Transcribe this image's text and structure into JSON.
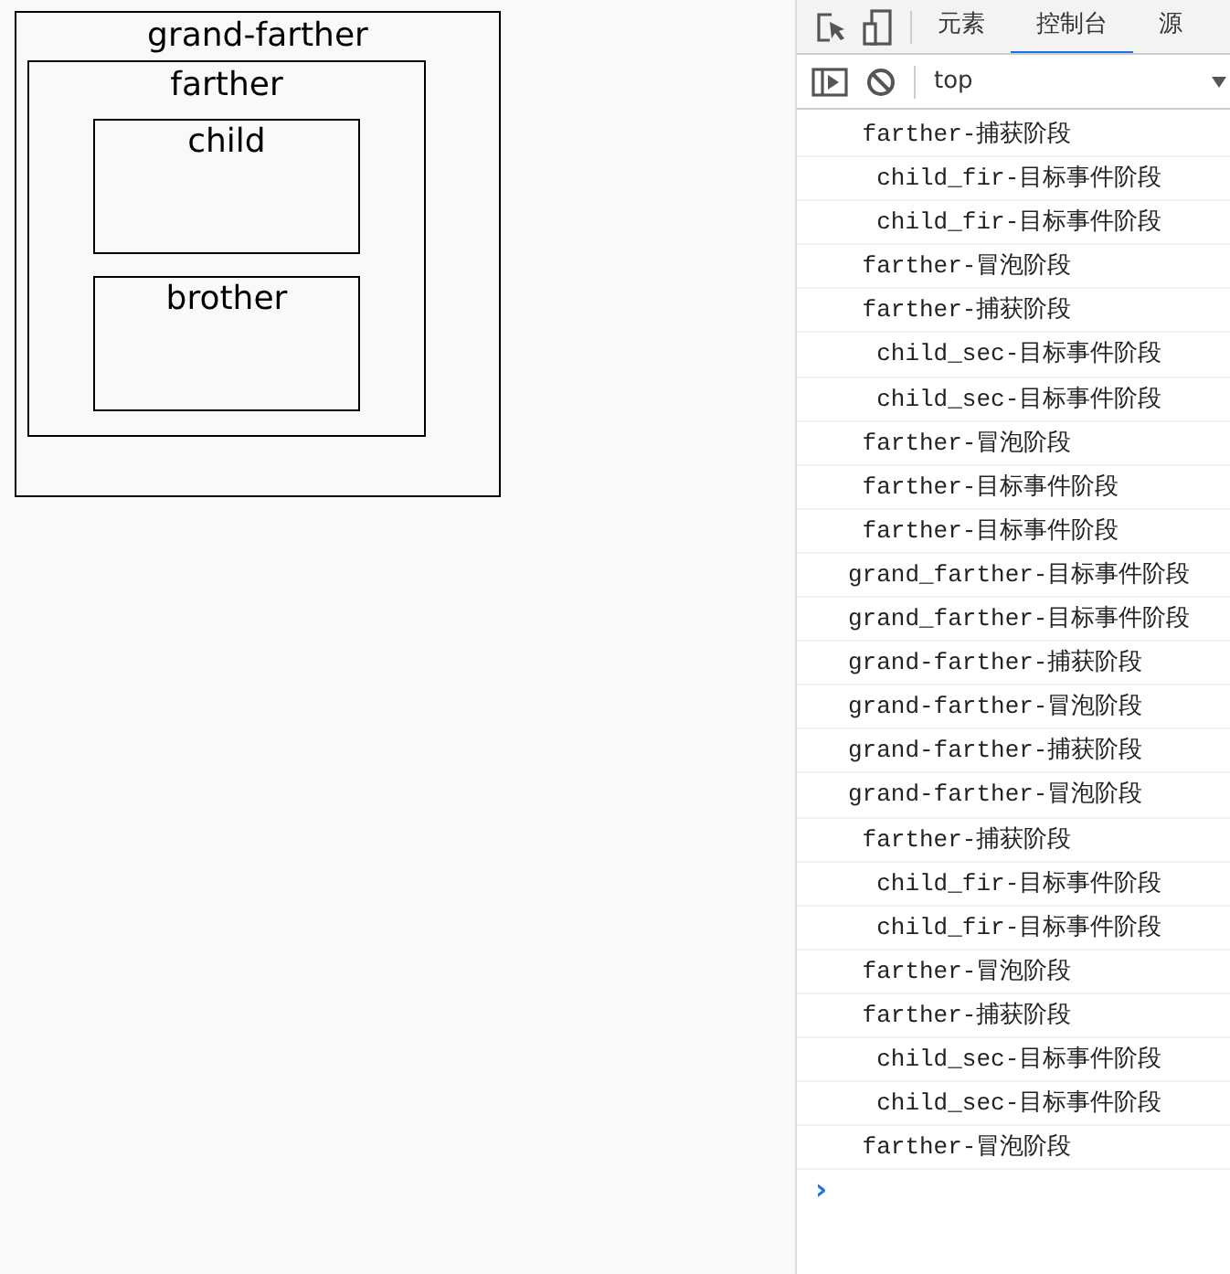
{
  "page": {
    "box": {
      "label": "grand-farther",
      "children": [
        {
          "label": "farther",
          "children": [
            {
              "label": "child"
            },
            {
              "label": "brother"
            }
          ]
        }
      ]
    }
  },
  "devtools": {
    "tabs": [
      {
        "label": "元素",
        "selected": false
      },
      {
        "label": "控制台",
        "selected": true
      },
      {
        "label": "源",
        "selected": false
      }
    ],
    "context": "top",
    "console": [
      " farther-捕获阶段",
      "  child_fir-目标事件阶段",
      "  child_fir-目标事件阶段",
      " farther-冒泡阶段",
      " farther-捕获阶段",
      "  child_sec-目标事件阶段",
      "  child_sec-目标事件阶段",
      " farther-冒泡阶段",
      " farther-目标事件阶段",
      " farther-目标事件阶段",
      "grand_farther-目标事件阶段",
      "grand_farther-目标事件阶段",
      "grand-farther-捕获阶段",
      "grand-farther-冒泡阶段",
      "grand-farther-捕获阶段",
      "grand-farther-冒泡阶段",
      " farther-捕获阶段",
      "  child_fir-目标事件阶段",
      "  child_fir-目标事件阶段",
      " farther-冒泡阶段",
      " farther-捕获阶段",
      "  child_sec-目标事件阶段",
      "  child_sec-目标事件阶段",
      " farther-冒泡阶段"
    ],
    "prompt": "›"
  }
}
